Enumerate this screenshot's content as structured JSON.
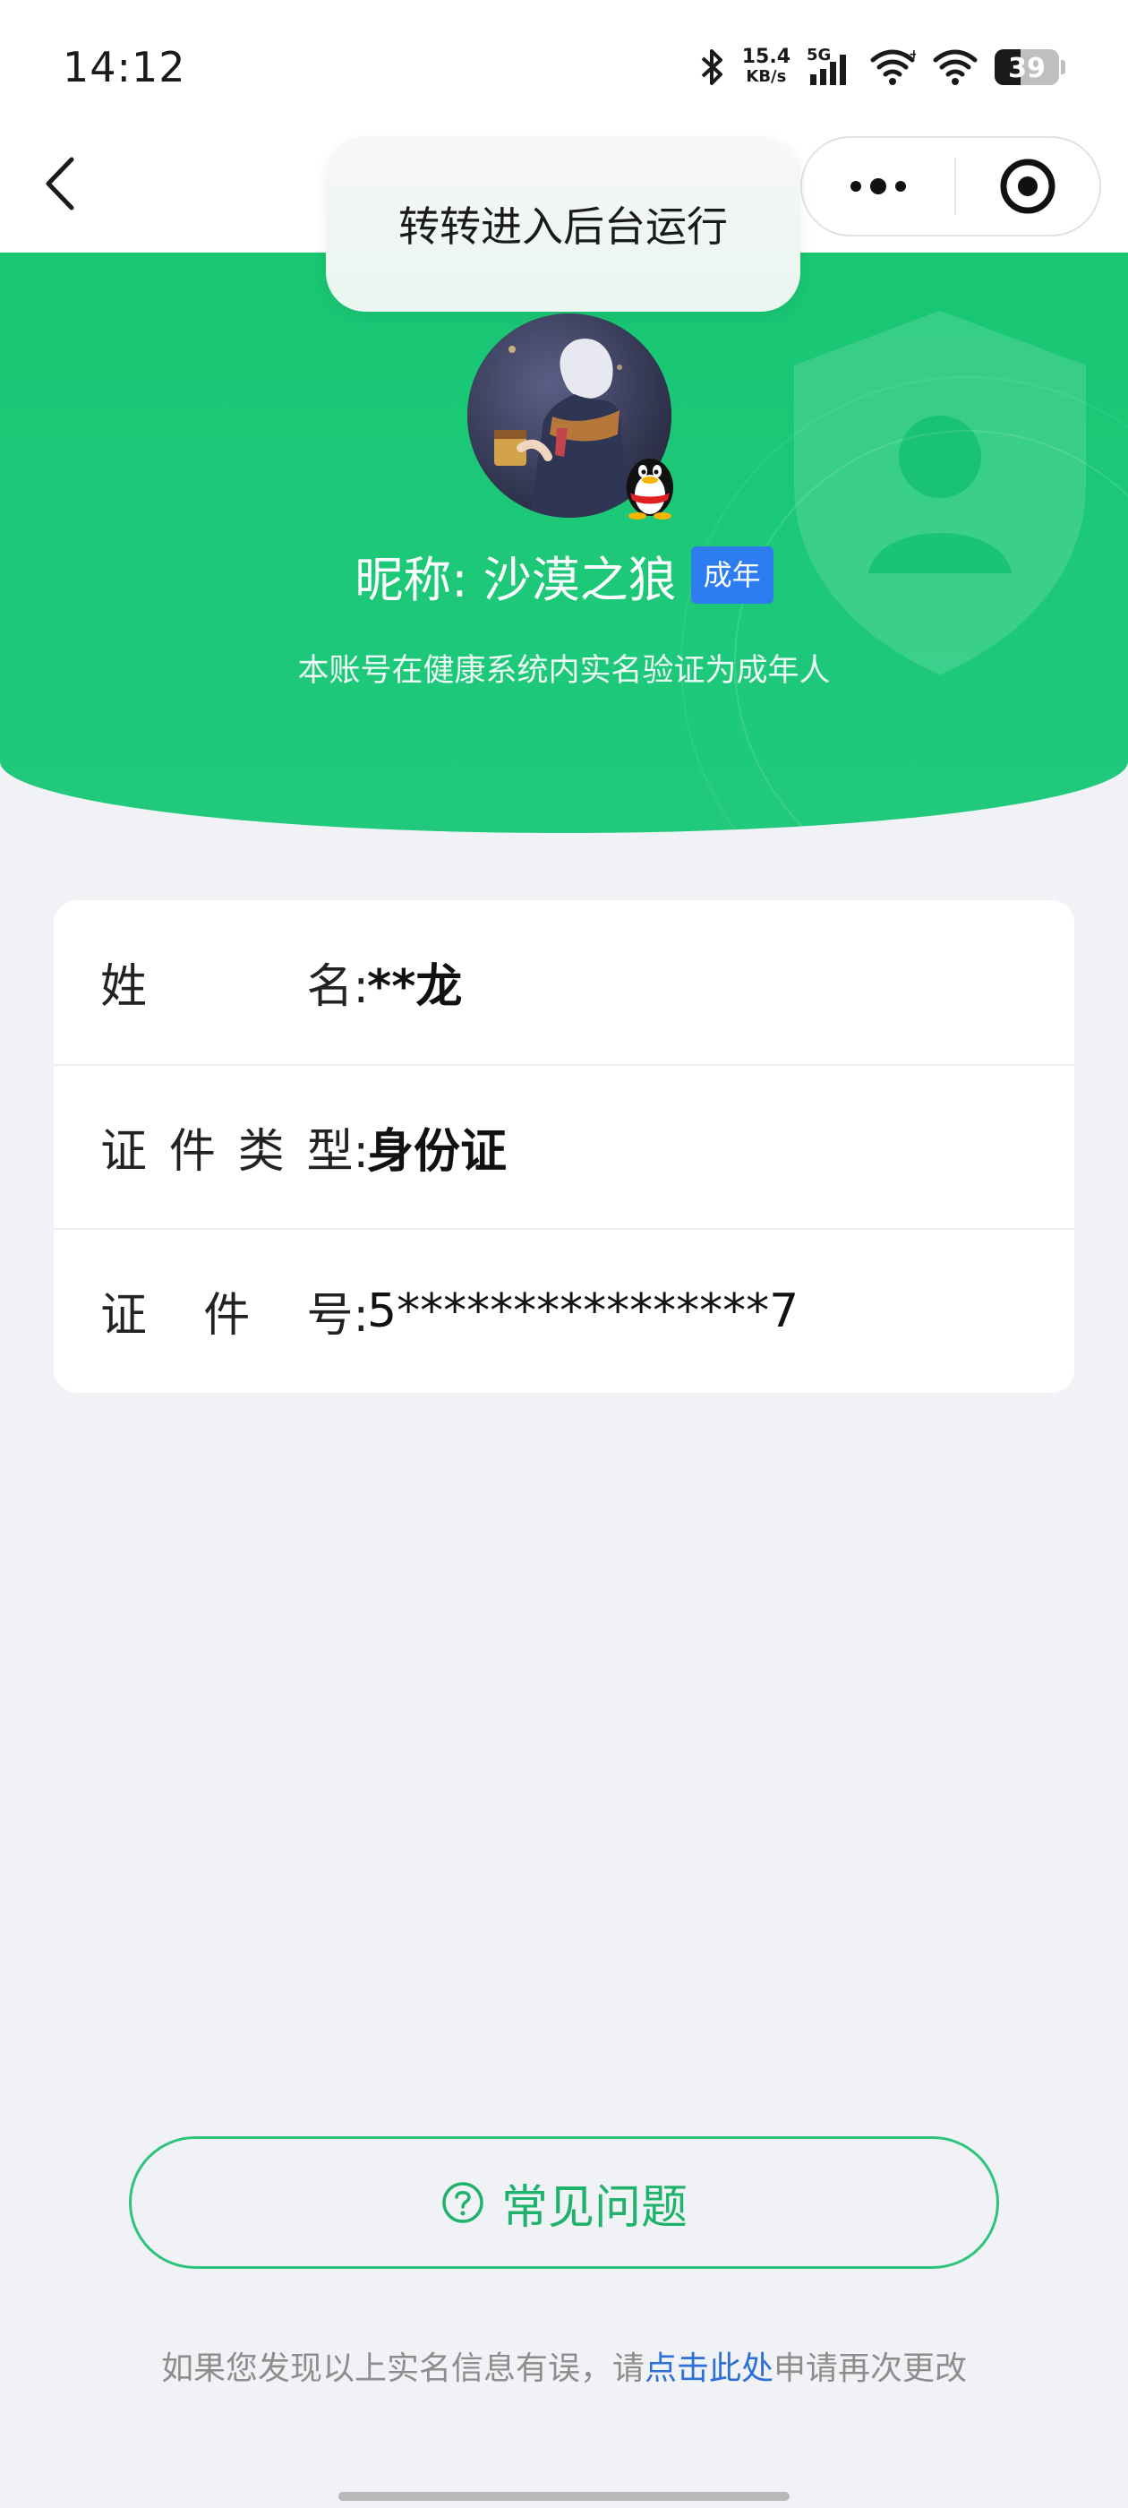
{
  "status_bar": {
    "time": "14:12",
    "net_speed_value": "15.4",
    "net_speed_unit": "KB/s",
    "network_type": "5G",
    "battery_level": "39"
  },
  "toast": {
    "text": "转转进入后台运行"
  },
  "profile": {
    "nickname": "昵称: 沙漠之狼",
    "adult_tag": "成年",
    "description": "本账号在健康系统内实名验证为成年人"
  },
  "info": {
    "rows": [
      {
        "label_chars": [
          "姓",
          "名:"
        ],
        "value": "**龙"
      },
      {
        "label_chars": [
          "证",
          "件",
          "类",
          "型:"
        ],
        "value": "身份证"
      },
      {
        "label_chars": [
          "证",
          "件",
          "号:"
        ],
        "value": "5****************7"
      }
    ]
  },
  "faq_button": {
    "label": "常见问题"
  },
  "footer": {
    "prefix": "如果您发现以上实名信息有误，请",
    "link": "点击此处",
    "suffix": "申请再次更改"
  },
  "colors": {
    "primary_green": "#1cc877",
    "tag_blue": "#2d7cf0",
    "link_blue": "#2d6fd6",
    "page_bg": "#f0f2f5"
  },
  "icons": {
    "back": "chevron-left-icon",
    "more": "more-dots-icon",
    "target": "target-icon",
    "faq": "question-circle-icon",
    "qq": "qq-penguin-icon",
    "shield": "shield-user-icon"
  }
}
